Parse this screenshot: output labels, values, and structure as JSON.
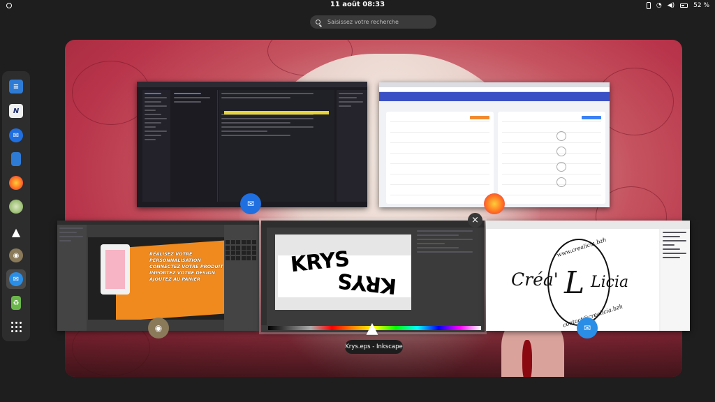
{
  "topbar": {
    "clock": "11 août 08:33",
    "battery": "52 %"
  },
  "search": {
    "placeholder": "Saisissez votre recherche"
  },
  "dock": {
    "items": [
      "libreoffice-writer-icon",
      "notes-icon",
      "thunderbird-icon",
      "libreoffice-impress-icon",
      "firefox-icon",
      "system-icon",
      "inkscape-icon",
      "gimp-icon",
      "thunderbird-active-icon",
      "trash-icon",
      "show-apps-icon"
    ]
  },
  "windows": {
    "gimp": {
      "promo": [
        "RÉALISEZ VOTRE",
        "PERSONNALISATION",
        "CONNECTEZ VOTRE PRODUIT",
        "IMPORTEZ VOTRE DESIGN",
        "AJOUTEZ AU PANIER"
      ]
    },
    "inkscape": {
      "text_top": "KRYS",
      "text_bottom": "KRYS"
    },
    "libreoffice": {
      "left_word": "Créa'",
      "center_letter": "L",
      "right_word": "Licia",
      "arc_top": "www.crealicia.bzh",
      "arc_bottom": "contact@crealicia.bzh"
    }
  },
  "caption": "Krys.eps - Inkscape",
  "colors": {
    "accent": "#3a7bd5",
    "firefox_nav": "#3b4fc5",
    "gimp_orange": "#f08a1e",
    "background_red": "#b8344a"
  }
}
